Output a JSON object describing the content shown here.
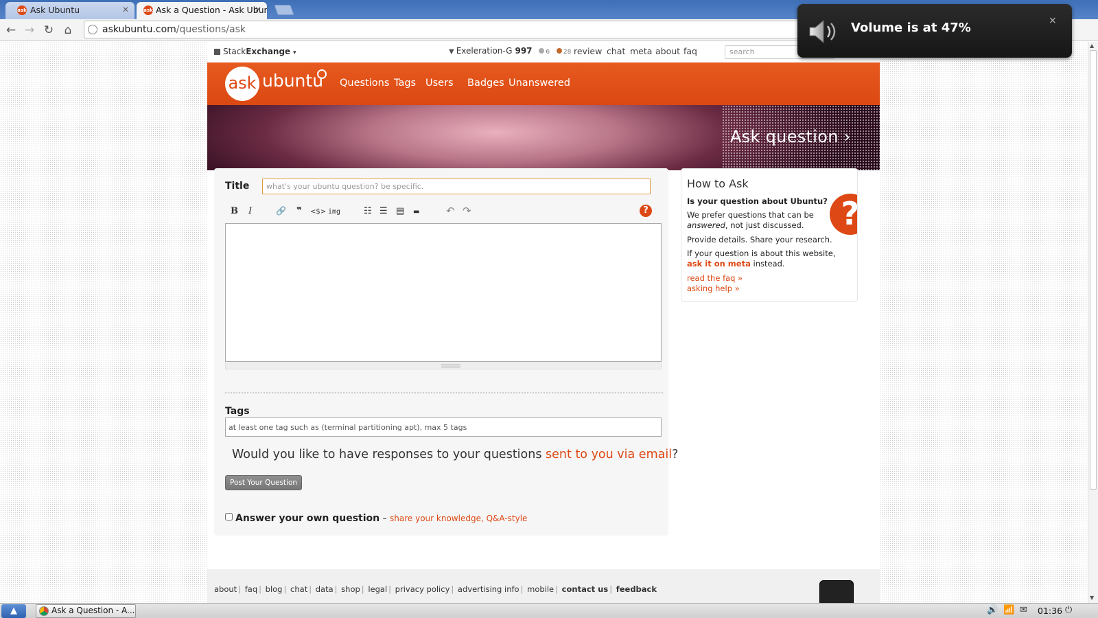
{
  "browser": {
    "tabs": [
      {
        "label": "Ask Ubuntu",
        "favicon": "ask"
      },
      {
        "label": "Ask a Question - Ask Ubun",
        "favicon": "ask"
      }
    ],
    "url_host": "askubuntu.com",
    "url_path": "/questions/ask"
  },
  "se_bar": {
    "network_prefix": "Stack",
    "network_bold": "Exchange",
    "username": "Exeleration-G",
    "reputation": "997",
    "silver_badges": "6",
    "bronze_badges": "28",
    "links": [
      "review",
      "chat",
      "meta",
      "about",
      "faq"
    ],
    "search_placeholder": "search"
  },
  "site": {
    "logo_ask": "ask",
    "logo_word": "ubuntu",
    "nav": [
      "Questions",
      "Tags",
      "Users",
      "Badges",
      "Unanswered"
    ],
    "page_heading": "Ask question ›"
  },
  "form": {
    "title_label": "Title",
    "title_placeholder": "what's your ubuntu question? be specific.",
    "toolbar": {
      "bold": "B",
      "italic": "I",
      "link": "🔗",
      "quote": "❞",
      "code": "<$>",
      "image": "img",
      "olist": "☷",
      "ulist": "☰",
      "heading": "▤",
      "hr": "▬",
      "undo": "↶",
      "redo": "↷",
      "help": "?"
    },
    "tags_label": "Tags",
    "tags_placeholder": "at least one tag such as (terminal partitioning apt), max 5 tags",
    "email_prompt_prefix": "Would you like to have responses to your questions",
    "email_prompt_link": "sent to you via email",
    "email_prompt_suffix": "?",
    "post_button": "Post Your Question",
    "answer_own_label": "Answer your own question",
    "answer_own_dash": "–",
    "answer_own_desc": "share your knowledge, Q&A-style"
  },
  "howto": {
    "title": "How to Ask",
    "question": "Is your question about Ubuntu?",
    "p1_line1": "We prefer questions that can be",
    "p1_answered": "answered",
    "p1_rest": ", not just discussed.",
    "p2": "Provide details. Share your research.",
    "p3_line1": "If your question is about this website,",
    "p3_link": "ask it on meta",
    "p3_rest": " instead.",
    "link_faq": "read the faq »",
    "link_help": "asking help »"
  },
  "footer": {
    "links": [
      "about",
      "faq",
      "blog",
      "chat",
      "data",
      "shop",
      "legal",
      "privacy policy",
      "advertising info",
      "mobile"
    ],
    "bold_links": [
      "contact us",
      "feedback"
    ]
  },
  "notification": {
    "text": "Volume is at 47%",
    "close": "×"
  },
  "taskbar": {
    "task_label": "Ask a Question - A...",
    "clock": "01:36"
  },
  "colors": {
    "accent": "#dd4814",
    "header_orange": "#e4541b",
    "tab_bar_blue": "#4a78bf"
  }
}
